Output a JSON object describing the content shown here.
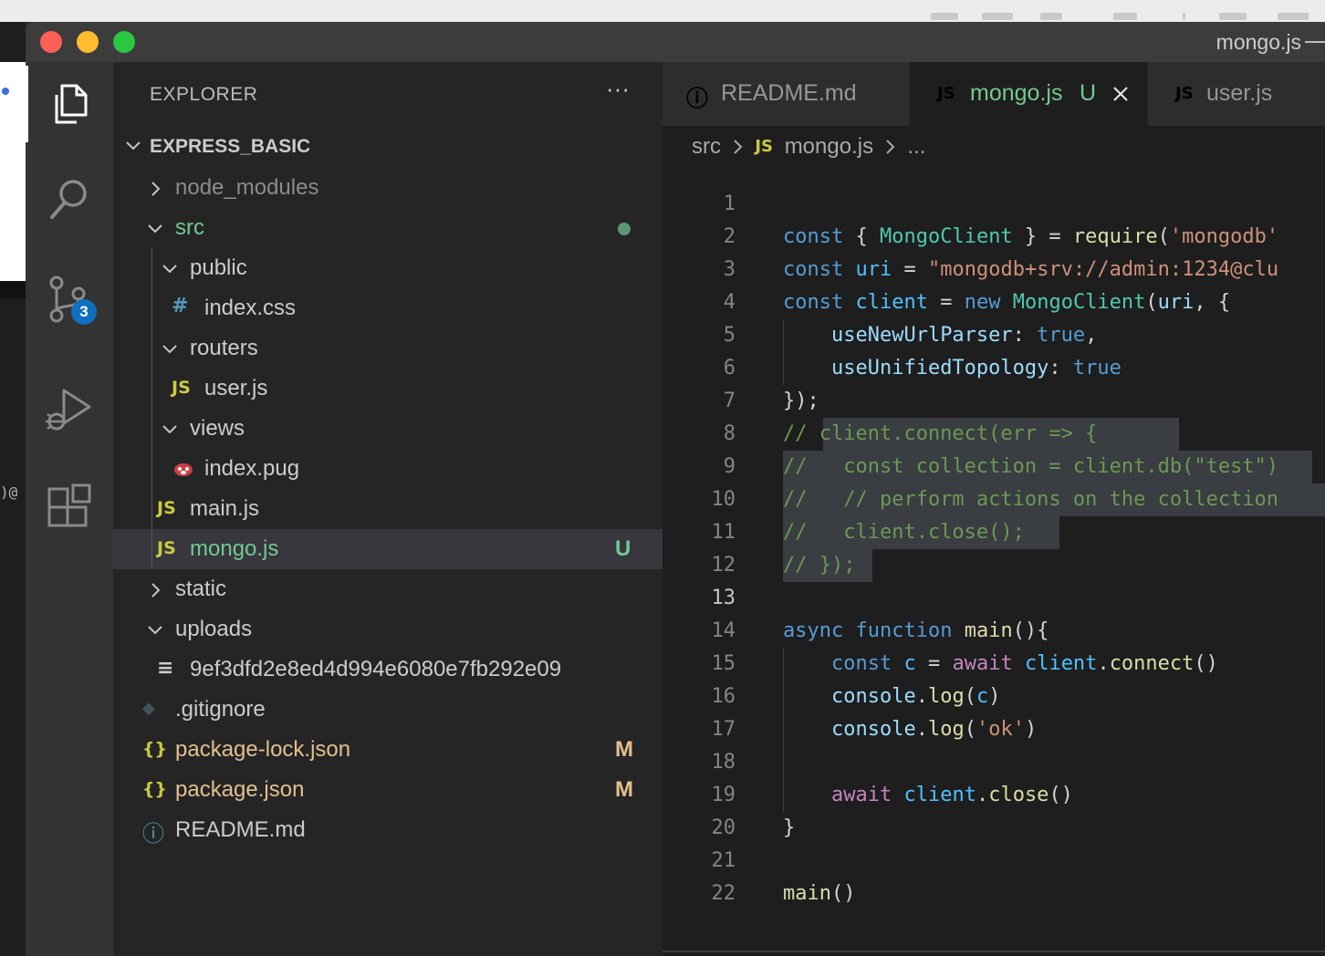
{
  "window": {
    "title": "mongo.js"
  },
  "activity_bar": {
    "scm_badge": "3"
  },
  "sidebar": {
    "header": "EXPLORER",
    "more": "···",
    "project": "EXPRESS_BASIC",
    "tree": [
      {
        "label": "node_modules",
        "kind": "folder",
        "expanded": false,
        "color": "#8c8c8c"
      },
      {
        "label": "src",
        "kind": "folder",
        "expanded": true,
        "color": "#73c991"
      },
      {
        "label": "public",
        "kind": "folder",
        "expanded": true
      },
      {
        "label": "index.css",
        "kind": "file",
        "icon": "#",
        "icon_color": "#519aba"
      },
      {
        "label": "routers",
        "kind": "folder",
        "expanded": true
      },
      {
        "label": "user.js",
        "kind": "file",
        "icon": "JS",
        "icon_color": "#cbcb41"
      },
      {
        "label": "views",
        "kind": "folder",
        "expanded": true
      },
      {
        "label": "index.pug",
        "kind": "file",
        "icon": "pug",
        "icon_color": "#cc3e44"
      },
      {
        "label": "main.js",
        "kind": "file",
        "icon": "JS",
        "icon_color": "#cbcb41"
      },
      {
        "label": "mongo.js",
        "kind": "file",
        "icon": "JS",
        "icon_color": "#cbcb41",
        "color": "#73c991",
        "status": "U",
        "status_color": "#73c991"
      },
      {
        "label": "static",
        "kind": "folder",
        "expanded": false
      },
      {
        "label": "uploads",
        "kind": "folder",
        "expanded": true
      },
      {
        "label": "9ef3dfd2e8ed4d994e6080e7fb292e09",
        "kind": "file",
        "icon": "≡",
        "icon_color": "#cccccc"
      },
      {
        "label": ".gitignore",
        "kind": "file",
        "icon": "◆",
        "icon_color": "#41535b"
      },
      {
        "label": "package-lock.json",
        "kind": "file",
        "icon": "{}",
        "icon_color": "#cbcb41",
        "color": "#e2c08d",
        "status": "M",
        "status_color": "#e2c08d"
      },
      {
        "label": "package.json",
        "kind": "file",
        "icon": "{}",
        "icon_color": "#cbcb41",
        "color": "#e2c08d",
        "status": "M",
        "status_color": "#e2c08d"
      },
      {
        "label": "README.md",
        "kind": "file",
        "icon": "ⓘ",
        "icon_color": "#519aba"
      }
    ]
  },
  "tabs": [
    {
      "label": "README.md",
      "icon": "ⓘ",
      "icon_color": "#519aba"
    },
    {
      "label": "mongo.js",
      "status": "U",
      "icon": "JS",
      "icon_color": "#cbcb41",
      "active": true
    },
    {
      "label": "user.js",
      "icon": "JS",
      "icon_color": "#cbcb41"
    }
  ],
  "breadcrumb": {
    "folder": "src",
    "file": "mongo.js",
    "rest": "..."
  },
  "editor": {
    "current_line": 13,
    "lines": [
      {
        "n": "1",
        "t": []
      },
      {
        "n": "2",
        "t": [
          [
            "const",
            "#569cd6"
          ],
          [
            " { ",
            "#d4d4d4"
          ],
          [
            "MongoClient",
            "#4ec9b0"
          ],
          [
            " } = ",
            "#d4d4d4"
          ],
          [
            "require",
            "#dcdcaa"
          ],
          [
            "(",
            "#d4d4d4"
          ],
          [
            "'mongodb'",
            "#ce9178"
          ]
        ]
      },
      {
        "n": "3",
        "t": [
          [
            "const",
            "#569cd6"
          ],
          [
            " ",
            "#d4d4d4"
          ],
          [
            "uri",
            "#4fc1ff"
          ],
          [
            " = ",
            "#d4d4d4"
          ],
          [
            "\"mongodb+srv://admin:1234@clu",
            "#ce9178"
          ]
        ]
      },
      {
        "n": "4",
        "t": [
          [
            "const",
            "#569cd6"
          ],
          [
            " ",
            "#d4d4d4"
          ],
          [
            "client",
            "#4fc1ff"
          ],
          [
            " = ",
            "#d4d4d4"
          ],
          [
            "new",
            "#569cd6"
          ],
          [
            " ",
            "#d4d4d4"
          ],
          [
            "MongoClient",
            "#4ec9b0"
          ],
          [
            "(",
            "#d4d4d4"
          ],
          [
            "uri",
            "#9cdcfe"
          ],
          [
            ", {",
            "#d4d4d4"
          ]
        ]
      },
      {
        "n": "5",
        "t": [
          [
            "    ",
            "#d4d4d4"
          ],
          [
            "useNewUrlParser",
            "#9cdcfe"
          ],
          [
            ": ",
            "#d4d4d4"
          ],
          [
            "true",
            "#569cd6"
          ],
          [
            ",",
            "#d4d4d4"
          ]
        ]
      },
      {
        "n": "6",
        "t": [
          [
            "    ",
            "#d4d4d4"
          ],
          [
            "useUnifiedTopology",
            "#9cdcfe"
          ],
          [
            ": ",
            "#d4d4d4"
          ],
          [
            "true",
            "#569cd6"
          ]
        ]
      },
      {
        "n": "7",
        "t": [
          [
            "});",
            "#d4d4d4"
          ]
        ]
      },
      {
        "n": "8",
        "t": [
          [
            "// client.connect(err => {",
            "#6a9955"
          ]
        ]
      },
      {
        "n": "9",
        "t": [
          [
            "//   const collection = client.db(\"test\")",
            "#6a9955"
          ]
        ]
      },
      {
        "n": "10",
        "t": [
          [
            "//   // perform actions on the collection",
            "#6a9955"
          ]
        ]
      },
      {
        "n": "11",
        "t": [
          [
            "//   client.close();",
            "#6a9955"
          ]
        ]
      },
      {
        "n": "12",
        "t": [
          [
            "// });",
            "#6a9955"
          ]
        ]
      },
      {
        "n": "13",
        "t": []
      },
      {
        "n": "14",
        "t": [
          [
            "async",
            "#569cd6"
          ],
          [
            " ",
            "#d4d4d4"
          ],
          [
            "function",
            "#569cd6"
          ],
          [
            " ",
            "#d4d4d4"
          ],
          [
            "main",
            "#dcdcaa"
          ],
          [
            "(){",
            "#d4d4d4"
          ]
        ]
      },
      {
        "n": "15",
        "t": [
          [
            "    ",
            "#d4d4d4"
          ],
          [
            "const",
            "#569cd6"
          ],
          [
            " ",
            "#d4d4d4"
          ],
          [
            "c",
            "#4fc1ff"
          ],
          [
            " = ",
            "#d4d4d4"
          ],
          [
            "await",
            "#c586c0"
          ],
          [
            " ",
            "#d4d4d4"
          ],
          [
            "client",
            "#4fc1ff"
          ],
          [
            ".",
            "#d4d4d4"
          ],
          [
            "connect",
            "#dcdcaa"
          ],
          [
            "()",
            "#d4d4d4"
          ]
        ]
      },
      {
        "n": "16",
        "t": [
          [
            "    ",
            "#d4d4d4"
          ],
          [
            "console",
            "#9cdcfe"
          ],
          [
            ".",
            "#d4d4d4"
          ],
          [
            "log",
            "#dcdcaa"
          ],
          [
            "(",
            "#d4d4d4"
          ],
          [
            "c",
            "#4fc1ff"
          ],
          [
            ")",
            "#d4d4d4"
          ]
        ]
      },
      {
        "n": "17",
        "t": [
          [
            "    ",
            "#d4d4d4"
          ],
          [
            "console",
            "#9cdcfe"
          ],
          [
            ".",
            "#d4d4d4"
          ],
          [
            "log",
            "#dcdcaa"
          ],
          [
            "(",
            "#d4d4d4"
          ],
          [
            "'ok'",
            "#ce9178"
          ],
          [
            ")",
            "#d4d4d4"
          ]
        ]
      },
      {
        "n": "18",
        "t": []
      },
      {
        "n": "19",
        "t": [
          [
            "    ",
            "#d4d4d4"
          ],
          [
            "await",
            "#c586c0"
          ],
          [
            " ",
            "#d4d4d4"
          ],
          [
            "client",
            "#4fc1ff"
          ],
          [
            ".",
            "#d4d4d4"
          ],
          [
            "close",
            "#dcdcaa"
          ],
          [
            "()",
            "#d4d4d4"
          ]
        ]
      },
      {
        "n": "20",
        "t": [
          [
            "}",
            "#d4d4d4"
          ]
        ]
      },
      {
        "n": "21",
        "t": []
      },
      {
        "n": "22",
        "t": [
          [
            "main",
            "#dcdcaa"
          ],
          [
            "()",
            "#d4d4d4"
          ]
        ]
      }
    ]
  }
}
